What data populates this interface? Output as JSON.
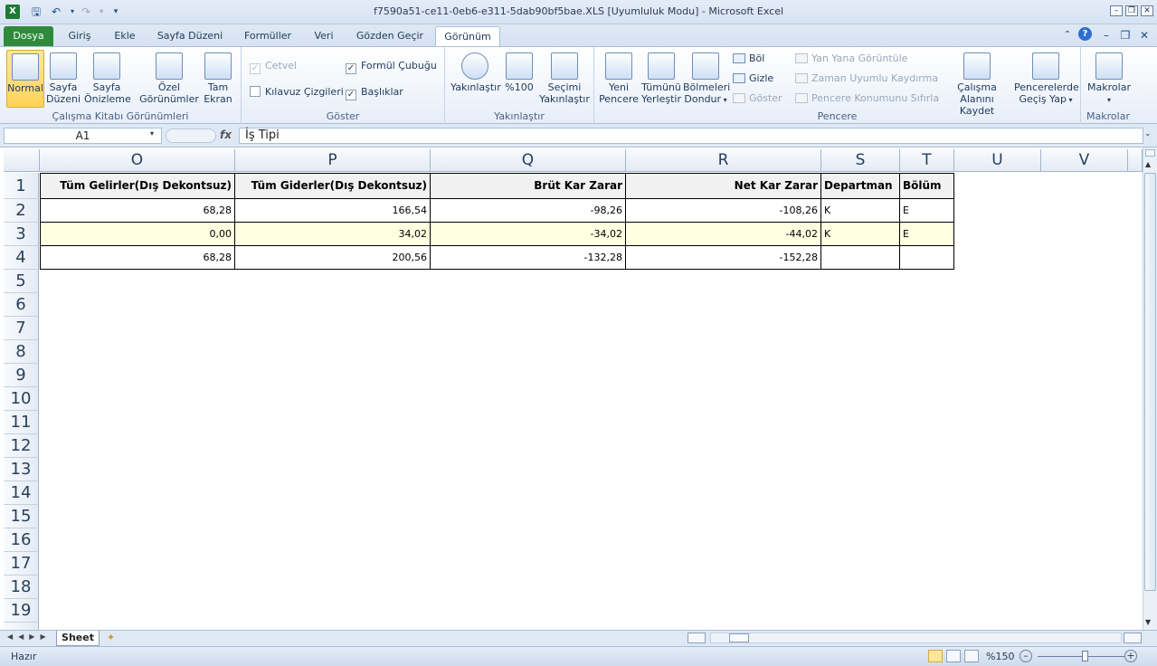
{
  "window": {
    "title": "f7590a51-ce11-0eb6-e311-5dab90bf5bae.XLS  [Uyumluluk Modu]  -  Microsoft Excel"
  },
  "tabs": [
    {
      "label": "Dosya"
    },
    {
      "label": "Giriş"
    },
    {
      "label": "Ekle"
    },
    {
      "label": "Sayfa Düzeni"
    },
    {
      "label": "Formüller"
    },
    {
      "label": "Veri"
    },
    {
      "label": "Gözden Geçir"
    },
    {
      "label": "Görünüm"
    }
  ],
  "ribbon": {
    "workbook_views": {
      "label": "Çalışma Kitabı Görünümleri",
      "normal": "Normal",
      "page_layout_1": "Sayfa",
      "page_layout_2": "Düzeni",
      "page_break_1": "Sayfa",
      "page_break_2": "Önizleme",
      "custom_1": "Özel",
      "custom_2": "Görünümler",
      "full_1": "Tam",
      "full_2": "Ekran"
    },
    "show": {
      "label": "Göster",
      "ruler": "Cetvel",
      "gridlines": "Kılavuz Çizgileri",
      "formula_bar": "Formül Çubuğu",
      "headings": "Başlıklar"
    },
    "zoom": {
      "label": "Yakınlaştır",
      "zoom_btn": "Yakınlaştır",
      "hundred": "%100",
      "selection_1": "Seçimi",
      "selection_2": "Yakınlaştır"
    },
    "window": {
      "label": "Pencere",
      "new_1": "Yeni",
      "new_2": "Pencere",
      "arrange_1": "Tümünü",
      "arrange_2": "Yerleştir",
      "freeze_1": "Bölmeleri",
      "freeze_2": "Dondur",
      "split": "Böl",
      "hide": "Gizle",
      "unhide": "Göster",
      "side_by_side": "Yan Yana Görüntüle",
      "sync_scroll": "Zaman Uyumlu Kaydırma",
      "reset_pos": "Pencere Konumunu Sıfırla",
      "save_ws_1": "Çalışma",
      "save_ws_2": "Alanını Kaydet",
      "switch_1": "Pencerelerde",
      "switch_2": "Geçiş Yap"
    },
    "macros": {
      "label": "Makrolar",
      "btn": "Makrolar"
    }
  },
  "formula_bar": {
    "name_box": "A1",
    "fx": "fx",
    "content": "İş Tipi"
  },
  "columns": [
    "O",
    "P",
    "Q",
    "R",
    "S",
    "T",
    "U",
    "V"
  ],
  "rows": [
    "1",
    "2",
    "3",
    "4",
    "5",
    "6",
    "7",
    "8",
    "9",
    "10",
    "11",
    "12",
    "13",
    "14",
    "15",
    "16",
    "17",
    "18",
    "19"
  ],
  "table": {
    "headers": [
      "Tüm Gelirler(Dış Dekontsuz)",
      "Tüm Giderler(Dış Dekontsuz)",
      "Brüt Kar Zarar",
      "Net Kar Zarar",
      "Departman",
      "Bölüm"
    ],
    "rows": [
      [
        "68,28",
        "166,54",
        "-98,26",
        "-108,26",
        "K",
        "E"
      ],
      [
        "0,00",
        "34,02",
        "-34,02",
        "-44,02",
        "K",
        "E"
      ],
      [
        "68,28",
        "200,56",
        "-132,28",
        "-152,28",
        "",
        ""
      ]
    ]
  },
  "sheet_tabs": [
    "Sheet"
  ],
  "status": {
    "ready": "Hazır",
    "zoom": "%150"
  }
}
